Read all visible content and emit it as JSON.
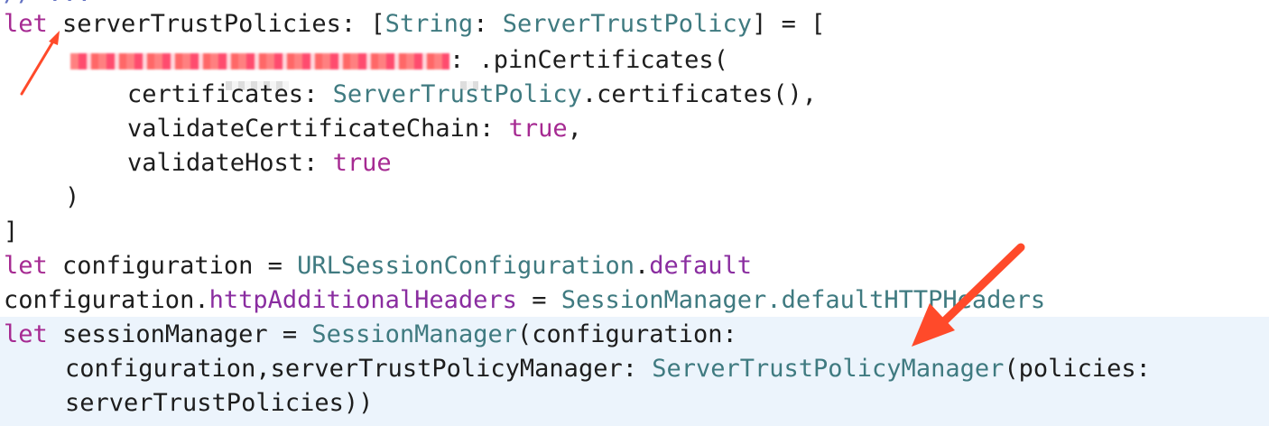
{
  "code": {
    "top_cut": "// ...",
    "line1": {
      "kw": "let",
      "name": " serverTrustPolicies: [",
      "type1": "String",
      "sep": ": ",
      "type2": "ServerTrustPolicy",
      "end": "] = ["
    },
    "line2": {
      "rest": ": .pinCertificates("
    },
    "line3": {
      "label": "certificates: ",
      "type": "ServerTrustPolicy",
      "method": ".certificates(),"
    },
    "line4": {
      "label": "validateCertificateChain: ",
      "value": "true",
      "end": ","
    },
    "line5": {
      "label": "validateHost: ",
      "value": "true"
    },
    "line6": {
      "text": ")"
    },
    "line7": {
      "text": "]"
    },
    "line8": {
      "kw": "let",
      "name": " configuration = ",
      "type": "URLSessionConfiguration",
      "dot": ".",
      "prop": "default"
    },
    "line9": {
      "obj": "configuration.",
      "prop": "httpAdditionalHeaders",
      "eq": " = ",
      "type": "SessionManager",
      "rest": ".defaultHTTPHeaders"
    },
    "line10": {
      "kw": "let",
      "name": " sessionManager = ",
      "type": "SessionManager",
      "rest": "(configuration:"
    },
    "line11": {
      "text": "configuration,serverTrustPolicyManager: ",
      "type": "ServerTrustPolicyManager",
      "rest": "(policies:"
    },
    "line12": {
      "text": "serverTrustPolicies))"
    }
  },
  "colors": {
    "keyword": "#a62a92",
    "type": "#3f7a80",
    "property": "#8a2da0",
    "highlight": "#ecf4fc",
    "annotation_arrow": "#ff4a2a"
  }
}
